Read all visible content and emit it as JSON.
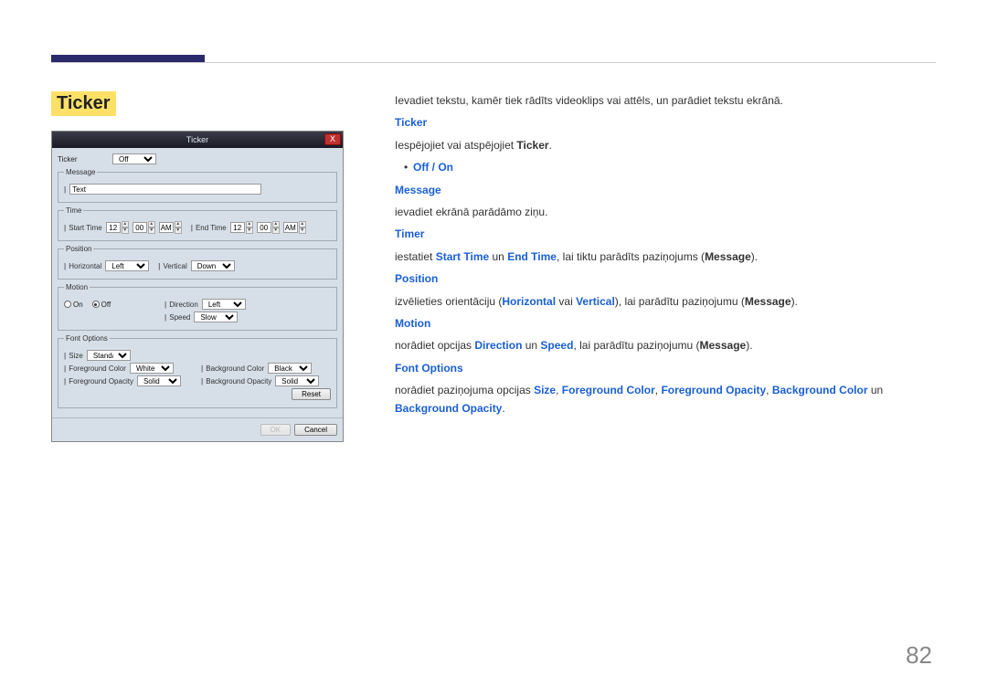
{
  "page_number": "82",
  "section_title": "Ticker",
  "dialog": {
    "title": "Ticker",
    "close_x": "X",
    "ticker_label": "Ticker",
    "ticker_value": "Off",
    "message_legend": "Message",
    "message_value": "Text",
    "time_legend": "Time",
    "start_time_label": "Start Time",
    "end_time_label": "End Time",
    "start_hh": "12",
    "start_mm": "00",
    "start_ampm": "AM",
    "end_hh": "12",
    "end_mm": "00",
    "end_ampm": "AM",
    "position_legend": "Position",
    "horizontal_label": "Horizontal",
    "horizontal_value": "Left",
    "vertical_label": "Vertical",
    "vertical_value": "Down",
    "motion_legend": "Motion",
    "motion_on_label": "On",
    "motion_off_label": "Off",
    "direction_label": "Direction",
    "direction_value": "Left",
    "speed_label": "Speed",
    "speed_value": "Slow",
    "font_legend": "Font Options",
    "size_label": "Size",
    "size_value": "Standard",
    "fg_color_label": "Foreground Color",
    "fg_color_value": "White",
    "bg_color_label": "Background Color",
    "bg_color_value": "Black",
    "fg_opacity_label": "Foreground Opacity",
    "fg_opacity_value": "Solid",
    "bg_opacity_label": "Background Opacity",
    "bg_opacity_value": "Solid",
    "reset_btn": "Reset",
    "ok_btn": "OK",
    "cancel_btn": "Cancel"
  },
  "doc": {
    "intro": "Ievadiet tekstu, kamēr tiek rādīts videoklips vai attēls, un parādiet tekstu ekrānā.",
    "ticker_h": "Ticker",
    "ticker_p_pre": "Iespējojiet vai atspējojiet ",
    "ticker_p_bold": "Ticker",
    "ticker_p_post": ".",
    "off_on": "Off / On",
    "message_h": "Message",
    "message_p": "ievadiet ekrānā parādāmo ziņu.",
    "timer_h": "Timer",
    "timer_pre": "iestatiet ",
    "timer_b1": "Start Time",
    "timer_mid1": " un ",
    "timer_b2": "End Time",
    "timer_post1": ", lai tiktu parādīts paziņojums (",
    "timer_msg": "Message",
    "timer_post2": ").",
    "position_h": "Position",
    "pos_pre": "izvēlieties orientāciju (",
    "pos_b1": "Horizontal",
    "pos_mid": " vai ",
    "pos_b2": "Vertical",
    "pos_post1": "), lai parādītu paziņojumu (",
    "pos_msg": "Message",
    "pos_post2": ").",
    "motion_h": "Motion",
    "mot_pre": "norādiet opcijas ",
    "mot_b1": "Direction",
    "mot_mid": " un ",
    "mot_b2": "Speed",
    "mot_post1": ", lai parādītu paziņojumu (",
    "mot_msg": "Message",
    "mot_post2": ").",
    "font_h": "Font Options",
    "font_pre": "norādiet paziņojuma opcijas ",
    "font_b1": "Size",
    "font_c1": ", ",
    "font_b2": "Foreground Color",
    "font_c2": ", ",
    "font_b3": "Foreground Opacity",
    "font_c3": ", ",
    "font_b4": "Background Color",
    "font_c4": " un ",
    "font_b5": "Background Opacity",
    "font_post": "."
  }
}
